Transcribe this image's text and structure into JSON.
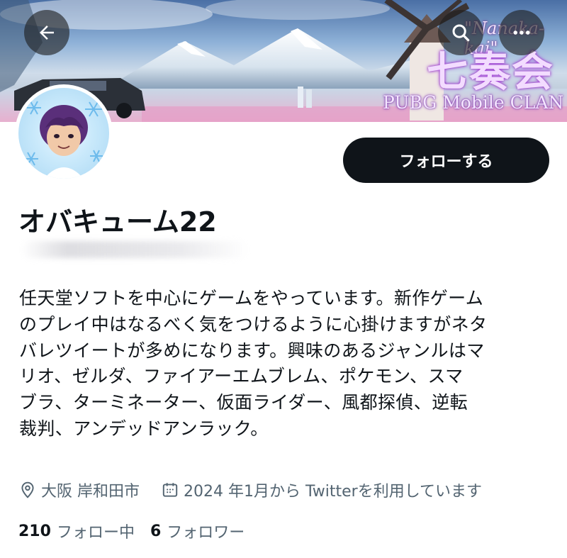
{
  "header": {
    "banner_title_top": "\"Nanaka-kai\"",
    "banner_clan_name": "七奏会",
    "banner_clan_sub": "PUBG Mobile CLAN"
  },
  "nav": {
    "back_icon": "arrow-left-icon",
    "search_icon": "search-icon",
    "more_icon": "more-icon"
  },
  "profile": {
    "follow_button_label": "フォローする",
    "display_name": "オバキューム22",
    "bio_lines": [
      "任天堂ソフトを中心にゲームをやっています。新作ゲーム",
      "のプレイ中はなるべく気をつけるように心掛けますがネタ",
      "バレツイートが多めになります。興味のあるジャンルはマ",
      "リオ、ゼルダ、ファイアーエムブレム、ポケモン、スマ",
      "ブラ、ターミネーター、仮面ライダー、風都探偵、逆転",
      "裁判、アンデッドアンラック。"
    ],
    "location": "大阪 岸和田市",
    "joined": "2024 年1月から Twitterを利用しています",
    "following_count": "210",
    "following_label": "フォロー中",
    "followers_count": "6",
    "followers_label": "フォロワー"
  },
  "colors": {
    "text_primary": "#0f1419",
    "text_secondary": "#536471",
    "button_bg": "#0f1419",
    "button_text": "#ffffff"
  }
}
